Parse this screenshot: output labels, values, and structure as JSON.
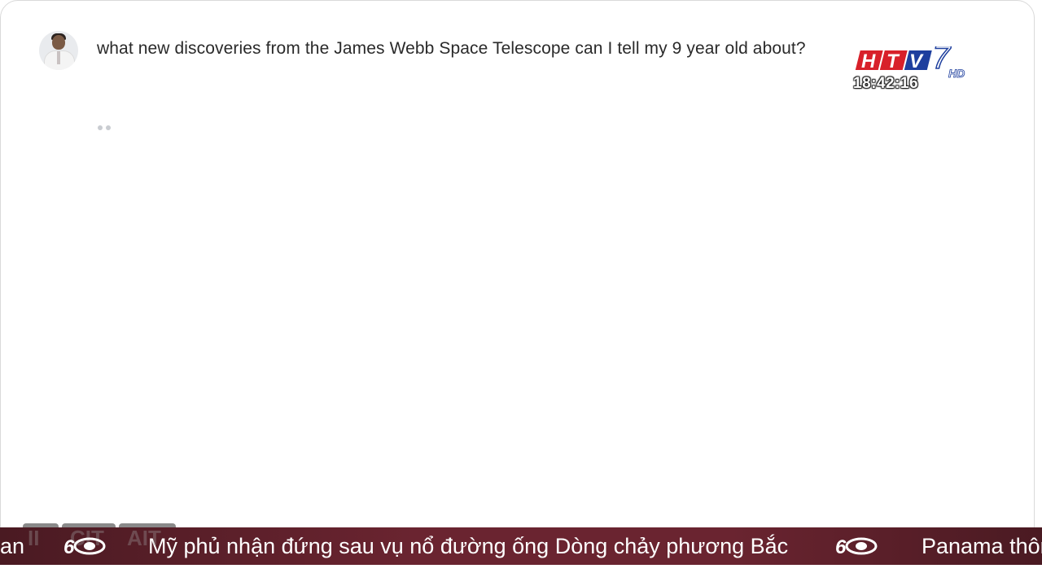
{
  "conversation": {
    "user_prompt": "what new discoveries from the James Webb Space Telescope can I tell my 9 year old about?",
    "avatar_icon": "user-avatar-photo",
    "response_state": "loading"
  },
  "overlay": {
    "channel_logo_text": "HTV7",
    "channel_logo_suffix": "HD",
    "clock": "18:42:16",
    "colors": {
      "logo_red": "#d8202a",
      "logo_blue": "#1e3f9e",
      "ticker_bg": "#6a2430"
    }
  },
  "ticker": {
    "left_fragment": "an",
    "headline": "Mỹ phủ nhận đứng sau vụ nổ đường ống Dòng chảy phương Bắc",
    "next_fragment": "Panama thôn",
    "ghost_labels": [
      "II",
      "CIT",
      "AIT"
    ],
    "separator_icon": "htv-60-logo-icon"
  }
}
